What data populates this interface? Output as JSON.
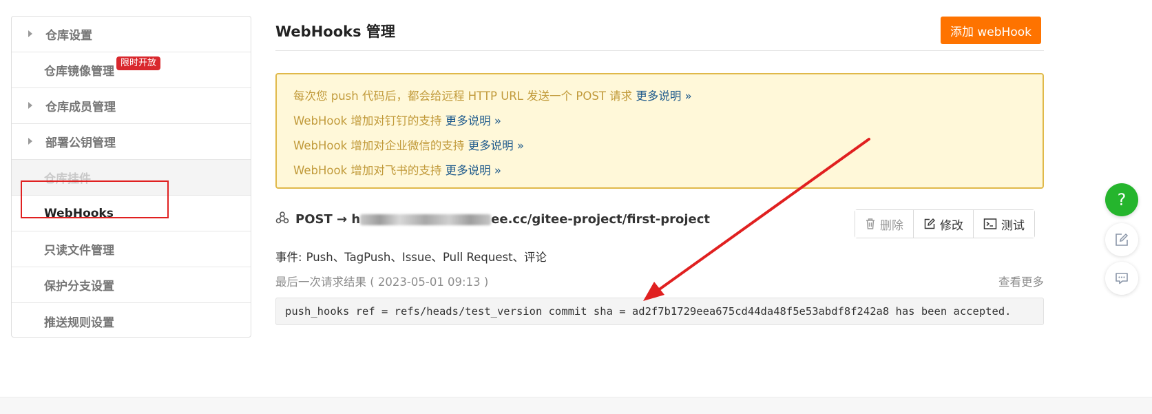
{
  "sidebar": {
    "items": [
      {
        "label": "仓库设置"
      },
      {
        "label": "仓库镜像管理",
        "badge": "限时开放"
      },
      {
        "label": "仓库成员管理"
      },
      {
        "label": "部署公钥管理"
      },
      {
        "label": "仓库挂件"
      },
      {
        "label": "WebHooks"
      },
      {
        "label": "只读文件管理"
      },
      {
        "label": "保护分支设置"
      },
      {
        "label": "推送规则设置"
      }
    ]
  },
  "header": {
    "title": "WebHooks 管理",
    "add_button": "添加 webHook"
  },
  "notice": {
    "lines": [
      {
        "text": "每次您 push 代码后，都会给远程 HTTP URL 发送一个 POST 请求 ",
        "link": "更多说明 »"
      },
      {
        "text": "WebHook 增加对钉钉的支持 ",
        "link": "更多说明 »"
      },
      {
        "text": "WebHook 增加对企业微信的支持 ",
        "link": "更多说明 »"
      },
      {
        "text": "WebHook 增加对飞书的支持 ",
        "link": "更多说明 »"
      }
    ]
  },
  "hook": {
    "method_prefix": "POST → h",
    "url_suffix": "ee.cc/gitee-project/first-project",
    "buttons": {
      "delete": "删除",
      "edit": "修改",
      "test": "测试"
    },
    "events_label": "事件:",
    "events_value": "Push、TagPush、Issue、Pull Request、评论",
    "last_result": "最后一次请求结果 ( 2023-05-01 09:13 )",
    "view_more": "查看更多",
    "log": "push_hooks ref = refs/heads/test_version commit sha = ad2f7b1729eea675cd44da48f5e53abdf8f242a8 has been accepted."
  },
  "floating": {
    "help": "?"
  },
  "colors": {
    "primary": "#fe7300",
    "notice_bg": "#fff8d9",
    "notice_text": "#c19a3a",
    "link": "#1e5a8c",
    "badge": "#d9282d",
    "annotation": "#e02020",
    "help_fab": "#25b52d"
  }
}
